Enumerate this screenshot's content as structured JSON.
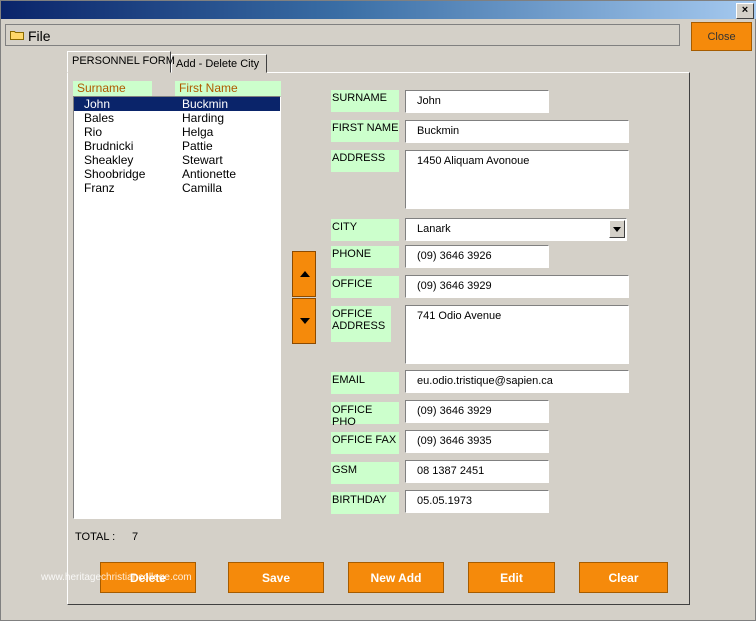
{
  "window": {
    "close_glyph": "×"
  },
  "menu": {
    "file_label": "File",
    "file_icon": "folder-icon"
  },
  "header_button": {
    "close_label": "Close"
  },
  "tabs": [
    {
      "label": "PERSONNEL FORM",
      "active": true
    },
    {
      "label": "Add - Delete City",
      "active": false
    }
  ],
  "list": {
    "columns": [
      "Surname",
      "First Name"
    ],
    "rows": [
      {
        "surname": "John",
        "first_name": "Buckmin",
        "selected": true
      },
      {
        "surname": "Bales",
        "first_name": "Harding"
      },
      {
        "surname": "Rio",
        "first_name": "Helga"
      },
      {
        "surname": "Brudnicki",
        "first_name": "Pattie"
      },
      {
        "surname": "Sheakley",
        "first_name": "Stewart"
      },
      {
        "surname": "Shoobridge",
        "first_name": "Antionette"
      },
      {
        "surname": "Franz",
        "first_name": "Camilla"
      }
    ]
  },
  "total": {
    "label": "TOTAL :",
    "value": "7"
  },
  "form": {
    "surname": {
      "label": "SURNAME",
      "value": "John"
    },
    "first_name": {
      "label": "FIRST NAME",
      "value": "Buckmin"
    },
    "address": {
      "label": "ADDRESS",
      "value": "1450 Aliquam Avonoue"
    },
    "city": {
      "label": "CITY",
      "value": "Lanark"
    },
    "phone": {
      "label": "PHONE",
      "value": "(09) 3646 3926"
    },
    "office": {
      "label": "OFFICE",
      "value": "(09) 3646 3929"
    },
    "office_address": {
      "label": "OFFICE ADDRESS",
      "value": "741 Odio Avenue"
    },
    "email": {
      "label": "EMAIL",
      "value": "eu.odio.tristique@sapien.ca"
    },
    "office_phone": {
      "label": "OFFICE PHO",
      "value": "(09) 3646 3929"
    },
    "office_fax": {
      "label": "OFFICE FAX",
      "value": "(09) 3646 3935"
    },
    "gsm": {
      "label": "GSM",
      "value": "08 1387 2451"
    },
    "birthday": {
      "label": "BIRTHDAY",
      "value": "05.05.1973"
    }
  },
  "buttons": {
    "delete": "Delete",
    "save": "Save",
    "new_add": "New Add",
    "edit": "Edit",
    "clear": "Clear"
  },
  "watermark": "www.heritagechristiancollege.com",
  "colors": {
    "accent": "#f58a0b",
    "label_bg": "#ccffcc",
    "selection": "#0a246a",
    "header_text": "#b05a00"
  }
}
